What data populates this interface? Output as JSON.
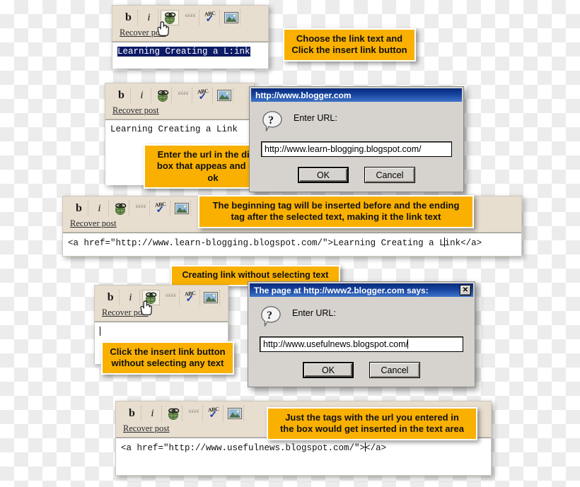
{
  "toolbar_icons": [
    {
      "name": "bold-icon",
      "glyph": "b"
    },
    {
      "name": "italic-icon",
      "glyph": "i"
    },
    {
      "name": "insert-link-icon",
      "glyph": "link"
    },
    {
      "name": "blockquote-icon",
      "glyph": "““"
    },
    {
      "name": "spellcheck-icon",
      "glyph": "ABC"
    },
    {
      "name": "insert-image-icon",
      "glyph": "image"
    }
  ],
  "spellcheck_label": "ABC",
  "recover_post_label": "Recover post",
  "step1": {
    "editor_text_selected": "Learning Creating a L:ink",
    "callout": "Choose the link text and\nClick the insert link button"
  },
  "step2": {
    "editor_text": "Learning Creating a Link",
    "callout": "Enter the url in the dialog\nbox that appeas and click ok",
    "dialog": {
      "title": "http://www.blogger.com",
      "prompt": "Enter URL:",
      "input_value": "http://www.learn-blogging.blogspot.com/",
      "ok_label": "OK",
      "cancel_label": "Cancel"
    }
  },
  "step3": {
    "callout": "The beginning tag will be inserted before and the ending\ntag after the selected text, making it the link text",
    "code_before": "<a href=\"http://www.learn-blogging.blogspot.com/\">Learning Creating a L",
    "code_after": "ink</a>"
  },
  "step4": {
    "section_heading": "Creating link without selecting text",
    "editor_text": "",
    "callout": "Click the insert link button\nwithout selecting any text",
    "dialog": {
      "title": "The page at http://www2.blogger.com says:",
      "close_label": "✕",
      "prompt": "Enter URL:",
      "input_value": "http://www.usefulnews.blogspot.com/",
      "ok_label": "OK",
      "cancel_label": "Cancel"
    }
  },
  "step5": {
    "callout": "Just the tags with the url you entered in\nthe box would get inserted in the text area",
    "code_before": "<a href=\"http://www.usefulnews.blogspot.com/\">",
    "code_after": "</a>"
  },
  "colors": {
    "callout_bg": "#f9b000",
    "callout_border": "#ffffff",
    "toolbar_bg": "#e7ded0",
    "selection_bg": "#0d1a66",
    "titlebar_blue": "#16439f",
    "dialog_face": "#d6d3ce"
  }
}
